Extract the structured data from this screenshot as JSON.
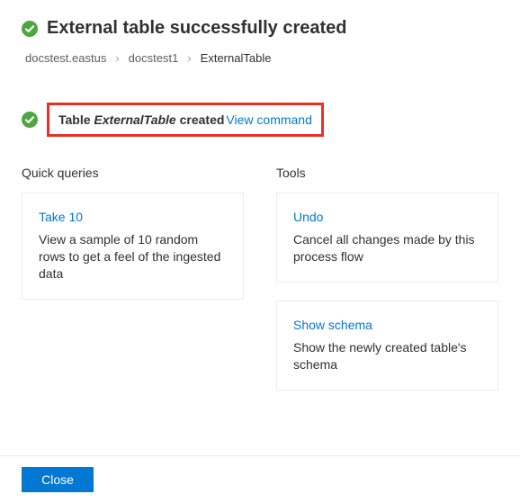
{
  "header": {
    "title": "External table successfully created"
  },
  "breadcrumb": {
    "items": [
      "docstest.eastus",
      "docstest1",
      "ExternalTable"
    ]
  },
  "status": {
    "prefix": "Table",
    "table_name": "ExternalTable",
    "suffix": "created",
    "view_command": "View command"
  },
  "quick_queries": {
    "heading": "Quick queries",
    "cards": [
      {
        "title": "Take 10",
        "desc": "View a sample of 10 random rows to get a feel of the ingested data"
      }
    ]
  },
  "tools": {
    "heading": "Tools",
    "cards": [
      {
        "title": "Undo",
        "desc": "Cancel all changes made by this process flow"
      },
      {
        "title": "Show schema",
        "desc": "Show the newly created table's schema"
      }
    ]
  },
  "footer": {
    "close": "Close"
  }
}
